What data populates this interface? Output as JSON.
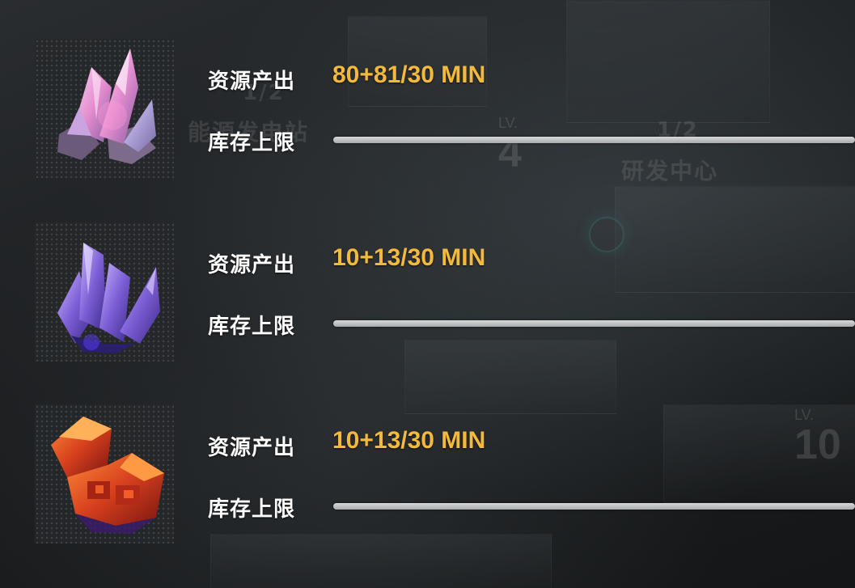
{
  "background": {
    "building_labels": [
      "能源发电站",
      "研发中心"
    ],
    "building_fractions": [
      "1/2",
      "1/2"
    ],
    "level_label": "LV.",
    "levels": [
      "4",
      "10"
    ]
  },
  "resources": [
    {
      "icon": "pink-crystal-icon",
      "output_label": "资源产出",
      "output_value": "80+81/30 MIN",
      "capacity_label": "库存上限",
      "capacity_fill": 1.0
    },
    {
      "icon": "purple-crystal-icon",
      "output_label": "资源产出",
      "output_value": "10+13/30 MIN",
      "capacity_label": "库存上限",
      "capacity_fill": 1.0
    },
    {
      "icon": "red-ore-icon",
      "output_label": "资源产出",
      "output_value": "10+13/30 MIN",
      "capacity_label": "库存上限",
      "capacity_fill": 1.0
    }
  ],
  "colors": {
    "accent_text": "#f3b93a",
    "label_text": "#ffffff",
    "bar": "#c6c8ca"
  }
}
